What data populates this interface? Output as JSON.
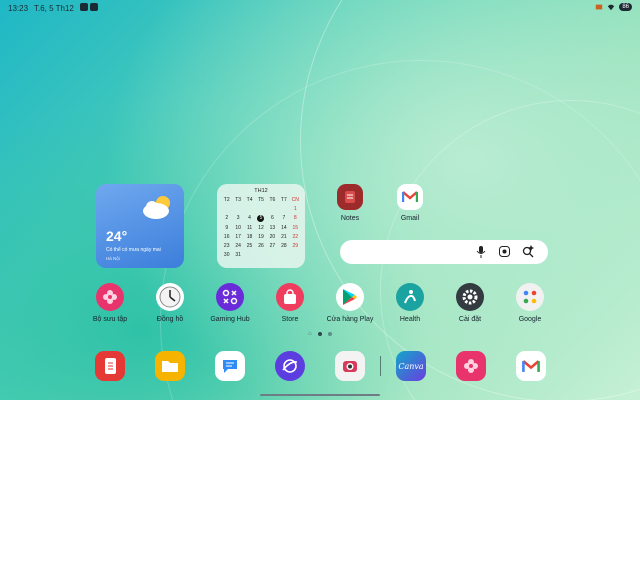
{
  "status_bar": {
    "time": "13:23",
    "date": "T.6, 5 Th12",
    "battery": "86"
  },
  "weather_widget": {
    "temperature": "24°",
    "description": "Có thể có mưa ngày mai",
    "city": "Hà Nội",
    "icon": "partly-cloudy-icon"
  },
  "calendar_widget": {
    "month": "TH12",
    "weekdays": [
      "T2",
      "T3",
      "T4",
      "T5",
      "T6",
      "T7",
      "CN"
    ],
    "days": [
      "",
      "",
      "",
      "",
      "",
      "",
      "1",
      "2",
      "3",
      "4",
      "5",
      "6",
      "7",
      "8",
      "9",
      "10",
      "11",
      "12",
      "13",
      "14",
      "15",
      "16",
      "17",
      "18",
      "19",
      "20",
      "21",
      "22",
      "23",
      "24",
      "25",
      "26",
      "27",
      "28",
      "29",
      "30",
      "31",
      "",
      "",
      "",
      ""
    ],
    "today": "5"
  },
  "home_apps_top": [
    {
      "label": "Notes",
      "icon": "notes-icon",
      "color": "#9e2b2b"
    },
    {
      "label": "Gmail",
      "icon": "gmail-icon",
      "color": "#ffffff"
    }
  ],
  "search_bar": {
    "mic_icon": "mic-icon",
    "lens_icon": "lens-icon",
    "ai_icon": "ai-search-icon"
  },
  "home_apps_row": [
    {
      "label": "Bộ sưu tập",
      "icon": "gallery-icon",
      "color": "#e8336d"
    },
    {
      "label": "Đồng hồ",
      "icon": "clock-icon",
      "color": "#ffffff"
    },
    {
      "label": "Gaming Hub",
      "icon": "gaming-hub-icon",
      "color": "#6a2cd8"
    },
    {
      "label": "Store",
      "icon": "store-icon",
      "color": "#ee3d5f"
    },
    {
      "label": "Cửa hàng Play",
      "icon": "play-store-icon",
      "color": "#ffffff"
    },
    {
      "label": "Health",
      "icon": "health-icon",
      "color": "#1aa3a0"
    },
    {
      "label": "Cài đặt",
      "icon": "settings-icon",
      "color": "#333a40"
    },
    {
      "label": "Google",
      "icon": "google-folder-icon",
      "color": "#f1f1f1"
    }
  ],
  "page_indicator": {
    "pages": 2,
    "active": 0
  },
  "dock": [
    {
      "icon": "samsung-notes-icon",
      "color": "#e53935"
    },
    {
      "icon": "my-files-icon",
      "color": "#f6b400"
    },
    {
      "icon": "messages-icon",
      "color": "#ffffff"
    },
    {
      "icon": "internet-icon",
      "color": "#5b3de0"
    },
    {
      "icon": "camera-icon",
      "color": "#f3f3f3"
    },
    {
      "icon": "canva-icon",
      "color": "#11a7c9",
      "text": "Canva"
    },
    {
      "icon": "gallery-icon",
      "color": "#e8336d"
    },
    {
      "icon": "gmail-icon",
      "color": "#ffffff"
    }
  ]
}
